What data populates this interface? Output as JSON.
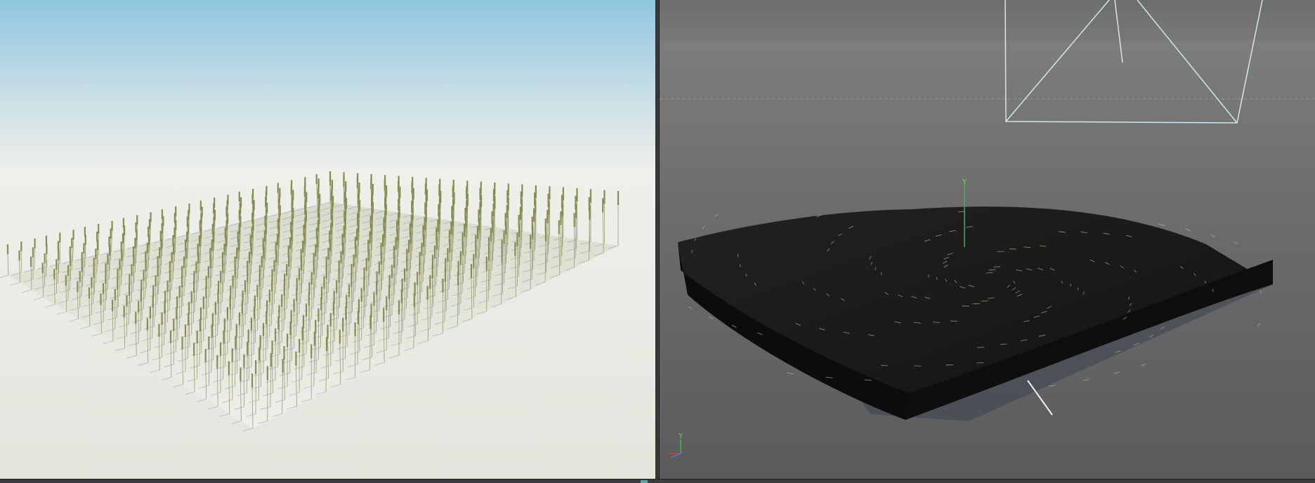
{
  "viewports": {
    "render": {
      "kind": "render-preview"
    },
    "editor": {
      "kind": "3d-perspective",
      "axis_gizmo": {
        "y_label": "Y",
        "colors": {
          "x": "#d04040",
          "y": "#4caf50",
          "z": "#4a7bd8"
        }
      },
      "object_axis_label": "Y"
    }
  },
  "colors": {
    "sky_top": "#8fc6e0",
    "haze": "#eef0ea",
    "ground": "#e6e8e1",
    "stalk": "#9a9a6a",
    "editor_bg_top": "#6a6a6a",
    "editor_bg_bottom": "#5e5e5e",
    "camera_wire": "#cfe8e8",
    "field_mesh": "#151515"
  }
}
